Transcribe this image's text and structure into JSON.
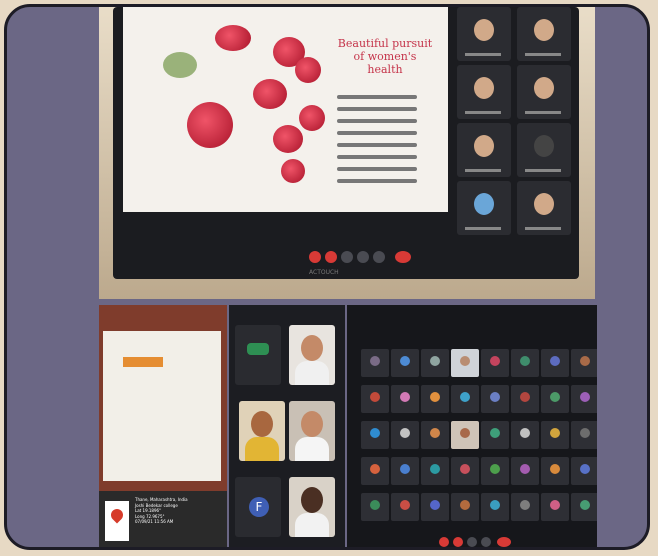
{
  "top_photo": {
    "slide_title": "Beautiful pursuit of women's health",
    "bezel_label": "ACTOUCH",
    "controls": [
      "mic",
      "camera",
      "chat",
      "hand",
      "share",
      "leave"
    ]
  },
  "bottom_left": {
    "geotag": "Thane, Maharashtra, India\nJoshi Bedekar college\nLat 19.1896°\nLong 72.9675°\n07/09/21 11:56 AM"
  },
  "bottom_middle": {
    "avatar_letter": "F"
  },
  "colors": {
    "frame": "#6b6785",
    "border": "#1d1c26"
  }
}
